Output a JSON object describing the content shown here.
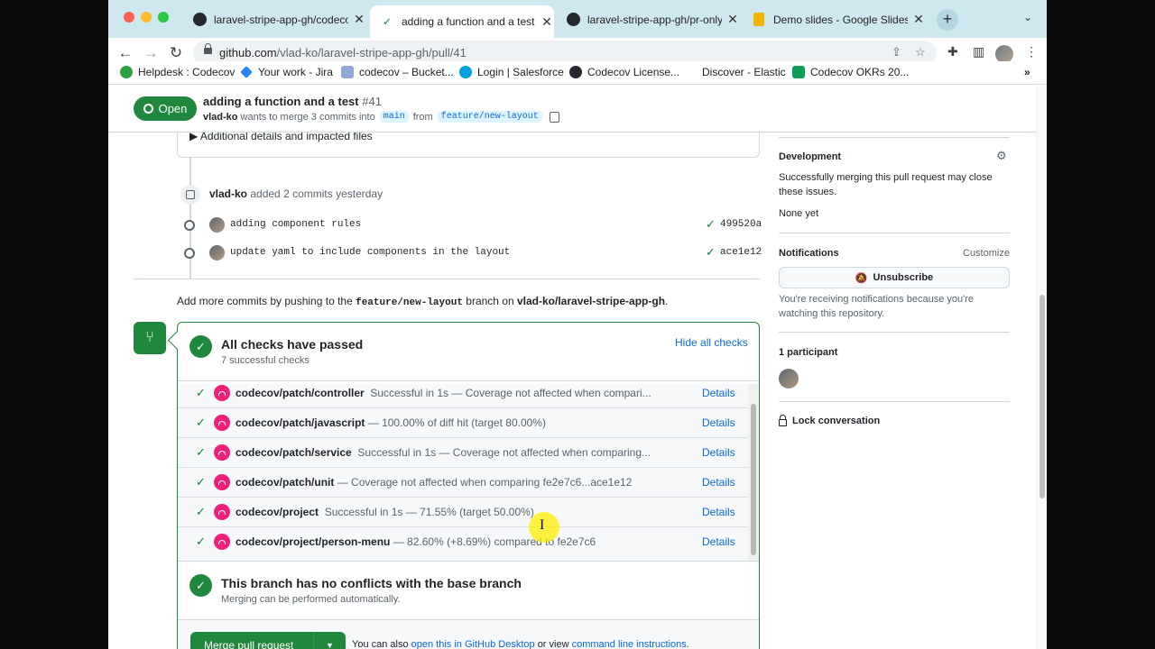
{
  "tabs": [
    {
      "title": "laravel-stripe-app-gh/codecov",
      "icon": "github-icon",
      "active": false
    },
    {
      "title": "adding a function and a test by",
      "icon": "check-icon",
      "active": true
    },
    {
      "title": "laravel-stripe-app-gh/pr-only.y",
      "icon": "github-icon",
      "active": false
    },
    {
      "title": "Demo slides - Google Slides",
      "icon": "google-slides-icon",
      "active": false
    }
  ],
  "toolbar": {
    "url_host": "github.com",
    "url_path": "/vlad-ko/laravel-stripe-app-gh/pull/41"
  },
  "bookmarks": [
    {
      "label": "Helpdesk : Codecov",
      "color": "#2ea043"
    },
    {
      "label": "Your work - Jira",
      "color": "#2684ff"
    },
    {
      "label": "codecov – Bucket...",
      "color": "#2684ff"
    },
    {
      "label": "Login | Salesforce",
      "color": "#00a1e0"
    },
    {
      "label": "Codecov License...",
      "color": "#24292f"
    },
    {
      "label": "Discover - Elastic",
      "color": "#ffffff"
    },
    {
      "label": "Codecov OKRs 20...",
      "color": "#0f9d58"
    }
  ],
  "pr": {
    "state": "Open",
    "title": "adding a function and a test",
    "number": "#41",
    "author": "vlad-ko",
    "merge_text": "wants to merge 3 commits into",
    "base": "main",
    "from_text": "from",
    "head": "feature/new-layout"
  },
  "timeline": {
    "details_summary": "▶ Additional details and impacted files",
    "push_author": "vlad-ko",
    "push_text": "added 2 commits yesterday",
    "commits": [
      {
        "message": "adding component rules",
        "sha": "499520a"
      },
      {
        "message": "update yaml to include components in the layout",
        "sha": "ace1e12"
      }
    ],
    "add_more_prefix": "Add more commits by pushing to the",
    "add_more_branch": "feature/new-layout",
    "add_more_mid": "branch on",
    "add_more_repo": "vlad-ko/laravel-stripe-app-gh",
    "add_more_end": "."
  },
  "checks": {
    "title": "All checks have passed",
    "subtitle": "7 successful checks",
    "hide_label": "Hide all checks",
    "details_label": "Details",
    "items": [
      {
        "name": "codecov/patch/controller",
        "desc": "Successful in 1s — Coverage not affected when compari..."
      },
      {
        "name": "codecov/patch/javascript",
        "desc": "— 100.00% of diff hit (target 80.00%)"
      },
      {
        "name": "codecov/patch/service",
        "desc": "Successful in 1s — Coverage not affected when comparing..."
      },
      {
        "name": "codecov/patch/unit",
        "desc": "— Coverage not affected when comparing fe2e7c6...ace1e12"
      },
      {
        "name": "codecov/project",
        "desc": "Successful in 1s — 71.55% (target 50.00%)"
      },
      {
        "name": "codecov/project/person-menu",
        "desc": "— 82.60% (+8.69%) compared to fe2e7c6"
      }
    ]
  },
  "merge": {
    "noconf_title": "This branch has no conflicts with the base branch",
    "noconf_sub": "Merging can be performed automatically.",
    "button": "Merge pull request",
    "also_prefix": "You can also",
    "also_link1": "open this in GitHub Desktop",
    "also_mid": "or view",
    "also_link2": "command line instructions",
    "also_end": "."
  },
  "sidebar": {
    "development_title": "Development",
    "development_text": "Successfully merging this pull request may close these issues.",
    "development_none": "None yet",
    "notifications_title": "Notifications",
    "customize": "Customize",
    "unsubscribe": "Unsubscribe",
    "notifications_text": "You're receiving notifications because you're watching this repository.",
    "participants": "1 participant",
    "lock": "Lock conversation"
  }
}
